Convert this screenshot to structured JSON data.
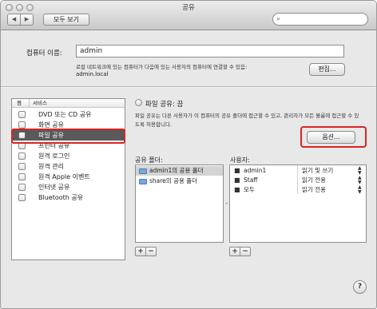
{
  "window": {
    "title": "공유"
  },
  "toolbar": {
    "back_label": "◀",
    "forward_label": "▶",
    "show_all_label": "모두 보기",
    "search_placeholder": ""
  },
  "computer_name": {
    "label": "컴퓨터 이름:",
    "value": "admin",
    "local_description": "로컬 네트워크에 있는 컴퓨터가 다음에 있는 사용자의 컴퓨터에 연결할 수 있음:",
    "local_address": "admin.local",
    "edit_label": "편집..."
  },
  "services": {
    "header_on": "켬",
    "header_service": "서비스",
    "items": [
      {
        "label": "DVD 또는 CD 공유"
      },
      {
        "label": "화면 공유"
      },
      {
        "label": "파일 공유"
      },
      {
        "label": "프린터 공유"
      },
      {
        "label": "원격 로그인"
      },
      {
        "label": "원격 관리"
      },
      {
        "label": "원격 Apple 이벤트"
      },
      {
        "label": "인터넷 공유"
      },
      {
        "label": "Bluetooth 공유"
      }
    ]
  },
  "detail": {
    "status": "파일 공유: 끔",
    "description": "파일 공유는 다른 사용자가 이 컴퓨터의 공유 폴더에 접근할 수 있고, 관리자가 모든 볼륨에 접근할 수 있도록 허용합니다.",
    "options_label": "옵션...",
    "shared_folders_label": "공유 폴더:",
    "users_label": "사용자:",
    "folders": [
      {
        "label": "admin1의 공용 폴더"
      },
      {
        "label": "share의 공용 폴더"
      }
    ],
    "users": [
      {
        "name": "admin1",
        "permission": "읽기 및 쓰기"
      },
      {
        "name": "Staff",
        "permission": "읽기 전용"
      },
      {
        "name": "모두",
        "permission": "읽기 전용"
      }
    ],
    "add_label": "+",
    "remove_label": "−"
  },
  "help_label": "?"
}
